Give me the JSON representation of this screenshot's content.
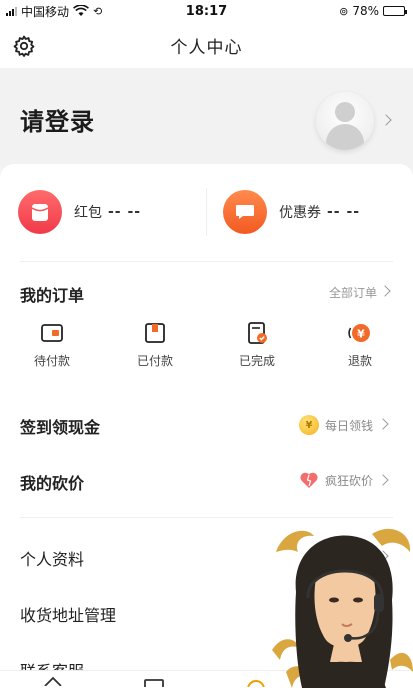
{
  "status_bar": {
    "carrier": "中国移动",
    "time": "18:17",
    "battery": "78%",
    "battery_level": 0.78
  },
  "nav": {
    "title": "个人中心"
  },
  "login": {
    "text": "请登录"
  },
  "wallet": {
    "hongbao_label": "红包",
    "hongbao_value": "-- --",
    "coupon_label": "优惠券",
    "coupon_value": "-- --"
  },
  "orders": {
    "title": "我的订单",
    "all_label": "全部订单",
    "items": [
      {
        "label": "待付款",
        "icon": "wallet-icon"
      },
      {
        "label": "已付款",
        "icon": "gift-box-icon"
      },
      {
        "label": "已完成",
        "icon": "checked-receipt-icon"
      },
      {
        "label": "退款",
        "icon": "yen-coin-icon"
      }
    ]
  },
  "rows": {
    "checkin": {
      "title": "签到领现金",
      "side": "每日领钱"
    },
    "bargain": {
      "title": "我的砍价",
      "side": "疯狂砍价"
    },
    "profile": {
      "title": "个人资料"
    },
    "address": {
      "title": "收货地址管理"
    },
    "service": {
      "title": "联系客服"
    }
  },
  "colors": {
    "red_icon": "#f03a4a",
    "orange_icon": "#f25a22",
    "coin": "#f3b21a"
  }
}
